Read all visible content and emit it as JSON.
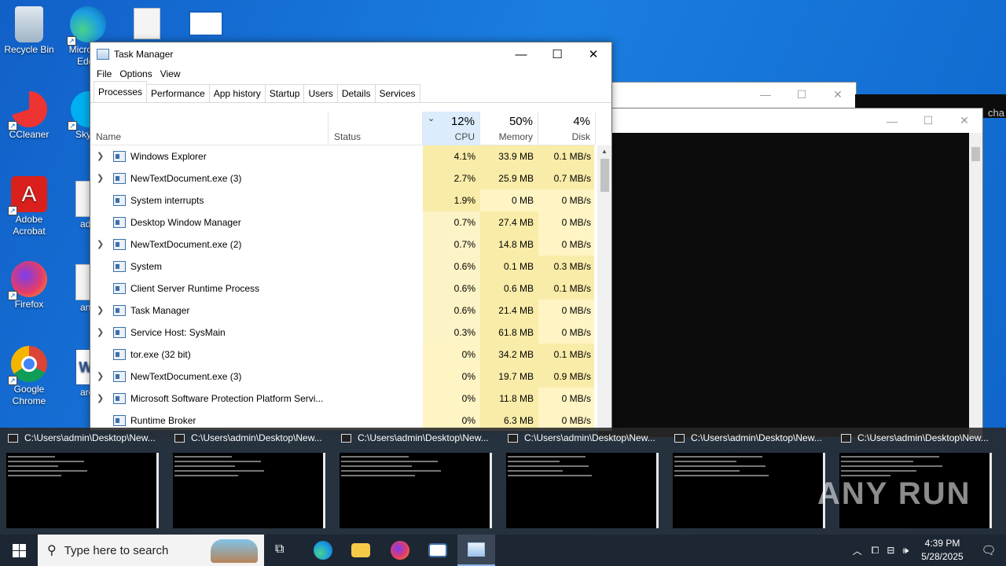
{
  "desktop": {
    "icons": [
      "Recycle Bin",
      "Microsoft Edge",
      "CCleaner",
      "Skype",
      "Adobe Acrobat",
      "advice",
      "Firefox",
      "answer",
      "Google Chrome",
      "around"
    ]
  },
  "taskmanager": {
    "title": "Task Manager",
    "menu": [
      "File",
      "Options",
      "View"
    ],
    "tabs": [
      "Processes",
      "Performance",
      "App history",
      "Startup",
      "Users",
      "Details",
      "Services"
    ],
    "columns": {
      "name": "Name",
      "status": "Status",
      "cpu": {
        "pct": "12%",
        "label": "CPU"
      },
      "memory": {
        "pct": "50%",
        "label": "Memory"
      },
      "disk": {
        "pct": "4%",
        "label": "Disk"
      }
    },
    "rows": [
      {
        "name": "Windows Explorer",
        "expand": true,
        "cpu": "4.1%",
        "mem": "33.9 MB",
        "disk": "0.1 MB/s"
      },
      {
        "name": "NewTextDocument.exe (3)",
        "expand": true,
        "cpu": "2.7%",
        "mem": "25.9 MB",
        "disk": "0.7 MB/s"
      },
      {
        "name": "System interrupts",
        "expand": false,
        "cpu": "1.9%",
        "mem": "0 MB",
        "disk": "0 MB/s"
      },
      {
        "name": "Desktop Window Manager",
        "expand": false,
        "cpu": "0.7%",
        "mem": "27.4 MB",
        "disk": "0 MB/s"
      },
      {
        "name": "NewTextDocument.exe (2)",
        "expand": true,
        "cpu": "0.7%",
        "mem": "14.8 MB",
        "disk": "0 MB/s"
      },
      {
        "name": "System",
        "expand": false,
        "cpu": "0.6%",
        "mem": "0.1 MB",
        "disk": "0.3 MB/s"
      },
      {
        "name": "Client Server Runtime Process",
        "expand": false,
        "cpu": "0.6%",
        "mem": "0.6 MB",
        "disk": "0.1 MB/s"
      },
      {
        "name": "Task Manager",
        "expand": true,
        "cpu": "0.6%",
        "mem": "21.4 MB",
        "disk": "0 MB/s"
      },
      {
        "name": "Service Host: SysMain",
        "expand": true,
        "cpu": "0.3%",
        "mem": "61.8 MB",
        "disk": "0 MB/s"
      },
      {
        "name": "tor.exe (32 bit)",
        "expand": false,
        "cpu": "0%",
        "mem": "34.2 MB",
        "disk": "0.1 MB/s"
      },
      {
        "name": "NewTextDocument.exe (3)",
        "expand": true,
        "cpu": "0%",
        "mem": "19.7 MB",
        "disk": "0.9 MB/s"
      },
      {
        "name": "Microsoft Software Protection Platform Servi...",
        "expand": true,
        "cpu": "0%",
        "mem": "11.8 MB",
        "disk": "0 MB/s"
      },
      {
        "name": "Runtime Broker",
        "expand": false,
        "cpu": "0%",
        "mem": "6.3 MB",
        "disk": "0 MB/s"
      }
    ]
  },
  "thumbnails": [
    "C:\\Users\\admin\\Desktop\\New...",
    "C:\\Users\\admin\\Desktop\\New...",
    "C:\\Users\\admin\\Desktop\\New...",
    "C:\\Users\\admin\\Desktop\\New...",
    "C:\\Users\\admin\\Desktop\\New...",
    "C:\\Users\\admin\\Desktop\\New..."
  ],
  "taskbar": {
    "search_placeholder": "Type here to search",
    "time": "4:39 PM",
    "date": "5/28/2025"
  },
  "watermark": "ANY RUN",
  "bg_text": "cha"
}
